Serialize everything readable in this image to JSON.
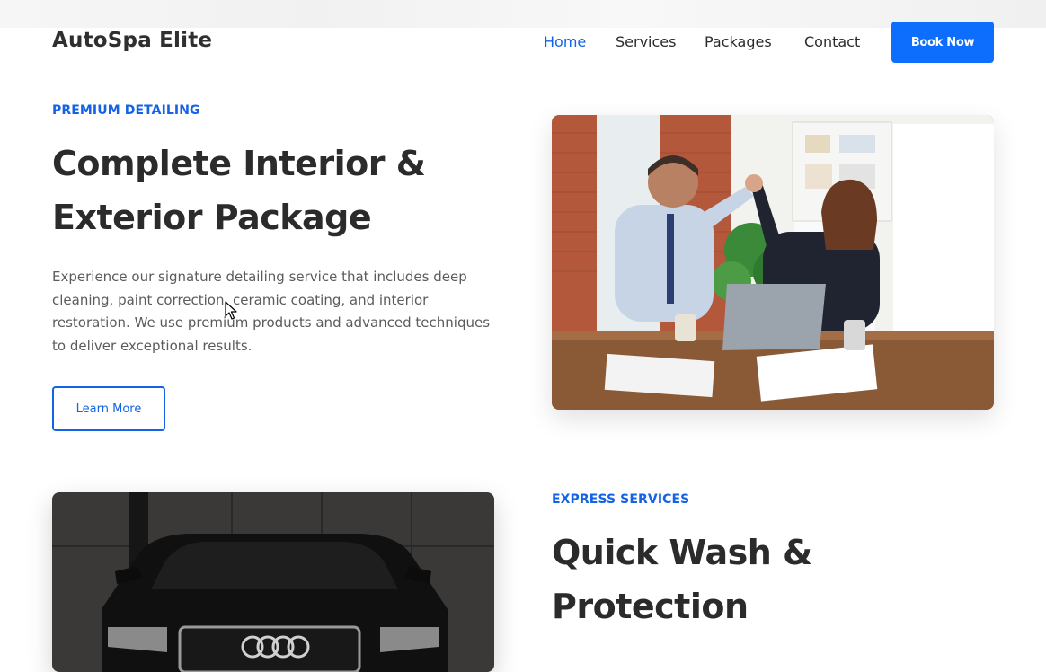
{
  "header": {
    "brand": "AutoSpa Elite",
    "nav": [
      {
        "label": "Home",
        "active": true
      },
      {
        "label": "Services",
        "active": false
      },
      {
        "label": "Packages",
        "active": false
      },
      {
        "label": "Contact",
        "active": false
      }
    ],
    "cta_label": "Book Now"
  },
  "section1": {
    "eyebrow": "PREMIUM DETAILING",
    "title_line1": "Complete Interior &",
    "title_line2": "Exterior Package",
    "description": "Experience our signature detailing service that includes deep cleaning, paint correction, ceramic coating, and interior restoration. We use premium products and advanced techniques to deliver exceptional results.",
    "button_label": "Learn More",
    "image_icon": "office-high-five-photo"
  },
  "section2": {
    "eyebrow": "EXPRESS SERVICES",
    "title_line1": "Quick Wash &",
    "title_line2": "Protection",
    "image_icon": "black-car-front-photo"
  },
  "colors": {
    "accent": "#1463e6",
    "button_bg": "#0d6efd",
    "heading": "#2b2b2b",
    "body_text": "#5b5b5b"
  },
  "cursor_icon": "arrow-cursor-icon"
}
